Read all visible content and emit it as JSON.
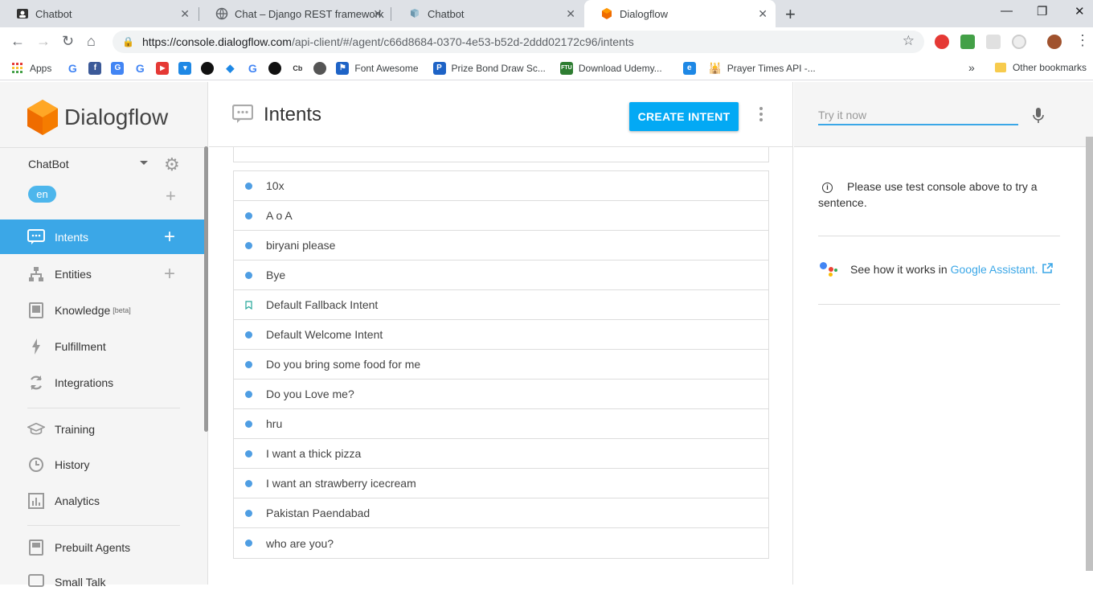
{
  "browser": {
    "tabs": [
      {
        "title": "Chatbot",
        "icon": "github-icon"
      },
      {
        "title": "Chat – Django REST framework",
        "icon": "globe-icon"
      },
      {
        "title": "Chatbot",
        "icon": "chatbot-icon"
      },
      {
        "title": "Dialogflow",
        "icon": "dialogflow-icon",
        "active": true
      }
    ],
    "url_host": "https://console.dialogflow.com",
    "url_path": "/api-client/#/agent/c66d8684-0370-4e53-b52d-2ddd02172c96/intents",
    "bookmarks": [
      {
        "label": "Apps",
        "icon": "apps-grid-icon"
      },
      {
        "label": "",
        "icon": "google-icon"
      },
      {
        "label": "",
        "icon": "facebook-icon"
      },
      {
        "label": "",
        "icon": "google-translate-icon"
      },
      {
        "label": "",
        "icon": "google-icon"
      },
      {
        "label": "",
        "icon": "youtube-icon"
      },
      {
        "label": "",
        "icon": "pocket-icon"
      },
      {
        "label": "",
        "icon": "github-icon"
      },
      {
        "label": "",
        "icon": "dropbox-icon"
      },
      {
        "label": "",
        "icon": "google-icon"
      },
      {
        "label": "",
        "icon": "github-icon"
      },
      {
        "label": "",
        "icon": "cb-icon"
      },
      {
        "label": "",
        "icon": "globe-icon"
      },
      {
        "label": "Font Awesome",
        "icon": "flag-icon"
      },
      {
        "label": "Prize Bond Draw Sc...",
        "icon": "p-icon"
      },
      {
        "label": "Download Udemy...",
        "icon": "ftu-icon"
      },
      {
        "label": "",
        "icon": "e-icon"
      },
      {
        "label": "Prayer Times API -...",
        "icon": "mosque-icon"
      }
    ],
    "overflow": "»",
    "other_bookmarks": "Other bookmarks"
  },
  "sidebar": {
    "brand": "Dialogflow",
    "agent_name": "ChatBot",
    "language": "en",
    "nav": [
      {
        "label": "Intents",
        "icon": "intents-icon",
        "active": true,
        "plus": true
      },
      {
        "label": "Entities",
        "icon": "entities-icon",
        "plus": true
      },
      {
        "label": "Knowledge",
        "icon": "knowledge-icon",
        "beta": "[beta]"
      },
      {
        "label": "Fulfillment",
        "icon": "lightning-icon"
      },
      {
        "label": "Integrations",
        "icon": "integrations-icon"
      },
      {
        "label": "Training",
        "icon": "training-icon"
      },
      {
        "label": "History",
        "icon": "history-icon"
      },
      {
        "label": "Analytics",
        "icon": "analytics-icon"
      },
      {
        "label": "Prebuilt Agents",
        "icon": "prebuilt-agents-icon"
      },
      {
        "label": "Small Talk",
        "icon": "small-talk-icon"
      }
    ]
  },
  "main": {
    "title": "Intents",
    "create_button": "CREATE INTENT",
    "intents": [
      {
        "name": "10x",
        "type": "dot"
      },
      {
        "name": "A o A",
        "type": "dot"
      },
      {
        "name": "biryani please",
        "type": "dot"
      },
      {
        "name": "Bye",
        "type": "dot"
      },
      {
        "name": "Default Fallback Intent",
        "type": "bookmark"
      },
      {
        "name": "Default Welcome Intent",
        "type": "dot"
      },
      {
        "name": "Do you bring some food for me",
        "type": "dot"
      },
      {
        "name": "Do you Love me?",
        "type": "dot"
      },
      {
        "name": "hru",
        "type": "dot"
      },
      {
        "name": "I want a thick pizza",
        "type": "dot"
      },
      {
        "name": "I want an strawberry icecream",
        "type": "dot"
      },
      {
        "name": "Pakistan Paendabad",
        "type": "dot"
      },
      {
        "name": "who are you?",
        "type": "dot"
      }
    ]
  },
  "console": {
    "placeholder": "Try it now",
    "info_text": "Please use test console above to try a sentence.",
    "assistant_prefix": "See how it works in",
    "assistant_link": "Google Assistant."
  },
  "colors": {
    "accent": "#3ba7e7",
    "create_button": "#03a9f4",
    "dot": "#4f9ee3",
    "fallback_bookmark": "#26a69a"
  }
}
